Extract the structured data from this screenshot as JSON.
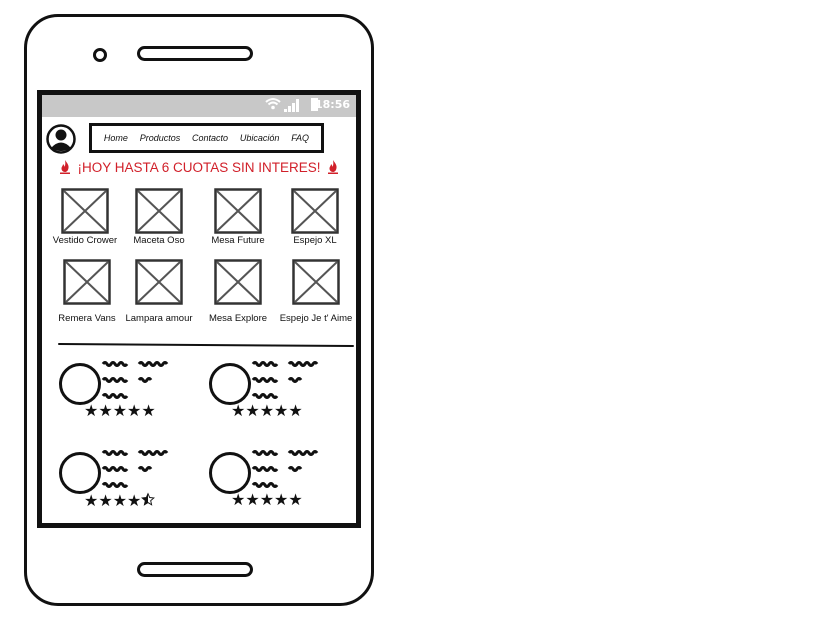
{
  "status_bar": {
    "time": "18:56",
    "wifi_icon": "wifi-icon",
    "signal_icon": "signal-icon",
    "battery_icon": "battery-icon"
  },
  "header": {
    "avatar_icon": "user-avatar-icon",
    "nav": [
      {
        "label": "Home"
      },
      {
        "label": "Productos"
      },
      {
        "label": "Contacto"
      },
      {
        "label": "Ubicación"
      },
      {
        "label": "FAQ"
      }
    ]
  },
  "promo": {
    "text": "¡HOY HASTA 6 CUOTAS SIN INTERES!",
    "icon": "flame-icon",
    "color": "#d1202a"
  },
  "products": [
    {
      "name": "Vestido Crower"
    },
    {
      "name": "Maceta Oso"
    },
    {
      "name": "Mesa Future"
    },
    {
      "name": "Espejo XL"
    },
    {
      "name": "Remera Vans"
    },
    {
      "name": "Lampara amour"
    },
    {
      "name": "Mesa Explore"
    },
    {
      "name": "Espejo Je t' Aime"
    }
  ],
  "reviews": [
    {
      "rating": 5
    },
    {
      "rating": 5
    },
    {
      "rating": 4.5
    },
    {
      "rating": 5
    }
  ],
  "colors": {
    "statusbar": "#c8c8c8",
    "ink": "#111111",
    "accent": "#d1202a"
  }
}
